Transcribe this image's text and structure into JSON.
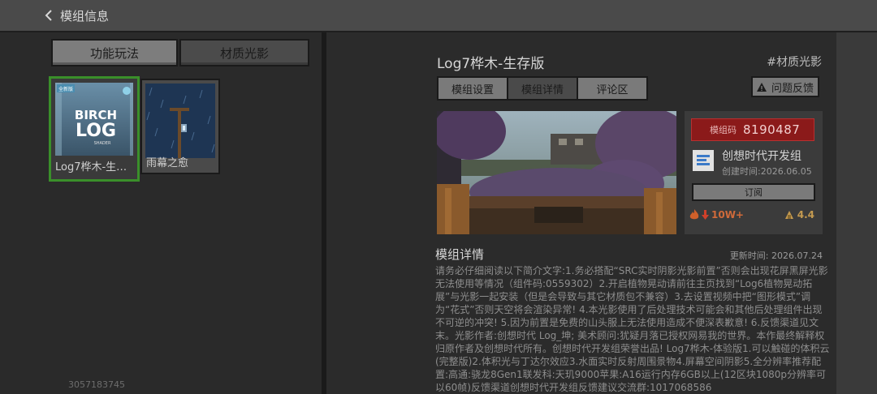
{
  "header": {
    "back_label": "模组信息"
  },
  "left": {
    "tabs": [
      {
        "label": "功能玩法",
        "active": false
      },
      {
        "label": "材质光影",
        "active": true
      }
    ],
    "cards": [
      {
        "label": "Log7桦木-生…",
        "selected": true,
        "thumb_text": "BIRCH LOG",
        "thumb_sub": "SHADER",
        "thumb_badge": "全新版"
      },
      {
        "label": "雨幕之愈",
        "selected": false
      }
    ],
    "footer_id": "3057183745"
  },
  "mod": {
    "title": "Log7桦木-生存版",
    "tag": "#材质光影",
    "tabs": [
      {
        "label": "模组设置",
        "active": false
      },
      {
        "label": "模组详情",
        "active": true
      },
      {
        "label": "评论区",
        "active": false
      }
    ],
    "report_label": "问题反馈",
    "code_label": "模组码",
    "code_value": "8190487",
    "developer": "创想时代开发组",
    "created": "创建时间:2026.06.05",
    "subscribe_label": "订阅",
    "hot": "10W+",
    "rating": "4.4",
    "detail_title": "模组详情",
    "update_time": "更新时间: 2026.07.24",
    "description": "请务必仔细阅读以下简介文字:1.务必搭配“SRC实时阴影光影前置”否则会出现花屏黑屏光影无法使用等情况（组件码:0559302）2.开启植物晃动请前往主页找到“Log6植物晃动拓展”与光影一起安装（但是会导致与其它材质包不兼容）3.去设置视频中把“图形模式”调为“花式”否则天空将会渲染异常! 4.本光影使用了后处理技术可能会和其他后处理组件出现不可逆的冲突! 5.因为前置是免费的山头服上无法使用造成不便深表歉意! 6.反馈渠道见文末。光影作者:创想时代 Log_坤; 美术顾问:犹疑月落已授权网易我的世界。本作最终解释权归原作者及创想时代所有。创想时代开发组荣誉出品! Log7桦木-体验版1.可以触碰的体积云(完整版)2.体积光与丁达尔效应3.水面实时反射周围景物4.屏幕空间阴影5.全分辨率推荐配置:高通:骁龙8Gen1联发科:天玑9000苹果:A16运行内存6GB以上(12区块1080p分辨率可以60帧)反馈渠道创想时代开发组反馈建议交流群:1017068586"
  },
  "colors": {
    "selected_border": "#3a8f2a",
    "code_badge": "#8b1a1a",
    "hot": "#d06a3a",
    "rating": "#c49a50"
  }
}
